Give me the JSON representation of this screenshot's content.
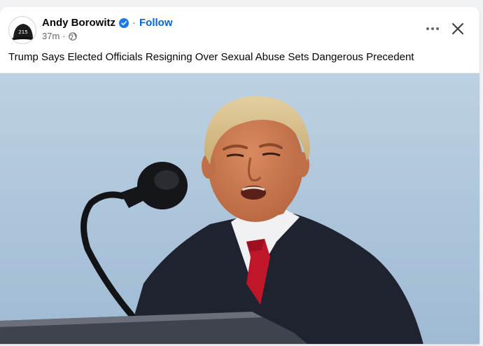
{
  "post": {
    "author": "Andy Borowitz",
    "separator": "·",
    "follow_label": "Follow",
    "timestamp": "37m",
    "meta_separator": "·",
    "audience_icon": "globe-icon",
    "caption": "Trump Says Elected Officials Resigning Over Sexual Abuse Sets Dangerous Precedent"
  },
  "avatar": {
    "icon": "baseball-cap-icon",
    "cap_text": "215"
  },
  "actions": {
    "more_icon": "more-options-icon",
    "close_icon": "close-icon"
  },
  "colors": {
    "follow": "#0064d1",
    "verified": "#1877f2",
    "secondary_text": "#65676b",
    "sky": "#a9c3d9",
    "tie": "#c0162a",
    "suit": "#1f2330"
  }
}
